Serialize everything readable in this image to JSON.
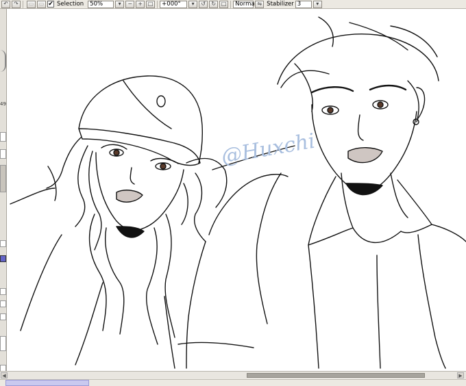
{
  "toolbar": {
    "undo_glyph": "↶",
    "redo_glyph": "↷",
    "selection_checked": "✔",
    "selection_label": "Selection",
    "zoom_value": "50%",
    "zoom_out_glyph": "−",
    "zoom_in_glyph": "+",
    "zoom_reset_glyph": "□",
    "rotation_value": "+000°",
    "rotate_ccw_glyph": "↺",
    "rotate_cw_glyph": "↻",
    "blend_mode_value": "Normal",
    "stabilizer_label": "Stabilizer",
    "stabilizer_value": "3"
  },
  "side": {
    "partial_number": "49"
  },
  "canvas": {
    "watermark": "@Huxchi"
  },
  "scroll": {
    "left_arrow": "◀",
    "right_arrow": "▶"
  },
  "colors": {
    "toolbar_bg": "#ece9e2",
    "workspace_bg": "#ffffff",
    "watermark": "#a9bfdf",
    "status_tab": "#c9c9ef"
  }
}
